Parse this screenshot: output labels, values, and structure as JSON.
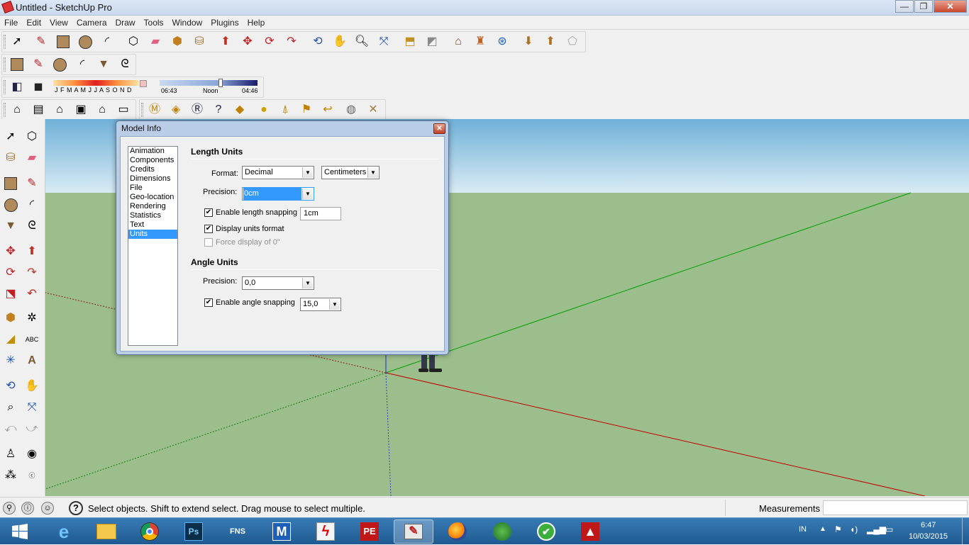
{
  "window": {
    "title": "Untitled - SketchUp Pro",
    "minimize": "—",
    "maximize": "❐",
    "close": "✕"
  },
  "menu": [
    "File",
    "Edit",
    "View",
    "Camera",
    "Draw",
    "Tools",
    "Window",
    "Plugins",
    "Help"
  ],
  "shadow_bar": {
    "months": "J F M A M J J A S O N D",
    "time_start": "06:43",
    "time_noon": "Noon",
    "time_end": "04:46"
  },
  "dialog": {
    "title": "Model Info",
    "close": "✕",
    "panels": [
      "Animation",
      "Components",
      "Credits",
      "Dimensions",
      "File",
      "Geo-location",
      "Rendering",
      "Statistics",
      "Text",
      "Units"
    ],
    "selected_panel": "Units",
    "length_units": {
      "heading": "Length Units",
      "format_label": "Format:",
      "format_value": "Decimal",
      "unit_value": "Centimeters",
      "precision_label": "Precision:",
      "precision_value": "0cm",
      "enable_length_snapping_label": "Enable length snapping",
      "enable_length_snapping": true,
      "length_snapping_value": "1cm",
      "display_units_format_label": "Display units format",
      "display_units_format": true,
      "force_display_label": "Force display of 0\"",
      "force_display": false
    },
    "angle_units": {
      "heading": "Angle Units",
      "precision_label": "Precision:",
      "precision_value": "0,0",
      "enable_angle_snapping_label": "Enable angle snapping",
      "enable_angle_snapping": true,
      "angle_snapping_value": "15,0"
    }
  },
  "status": {
    "text": "Select objects. Shift to extend select. Drag mouse to select multiple.",
    "measurements_label": "Measurements",
    "measurements_value": ""
  },
  "taskbar": {
    "apps": [
      "start",
      "internet-explorer",
      "file-explorer",
      "chrome",
      "photoshop",
      "fns",
      "m-app",
      "red-app",
      "pe-app",
      "sketchup",
      "firefox",
      "globe-app",
      "green-app",
      "autocad"
    ],
    "app_labels": {
      "photoshop": "Ps",
      "fns": "FNS",
      "m-app": "M",
      "pe-app": "PE"
    },
    "lang": "IN",
    "time": "6:47",
    "date": "10/03/2015"
  },
  "colors": {
    "sky": "#6fb0d8",
    "ground": "#9cbd8c",
    "red_axis": "#c00000",
    "green_axis": "#00a000",
    "blue_axis": "#2030c0",
    "selection": "#3399ff"
  }
}
